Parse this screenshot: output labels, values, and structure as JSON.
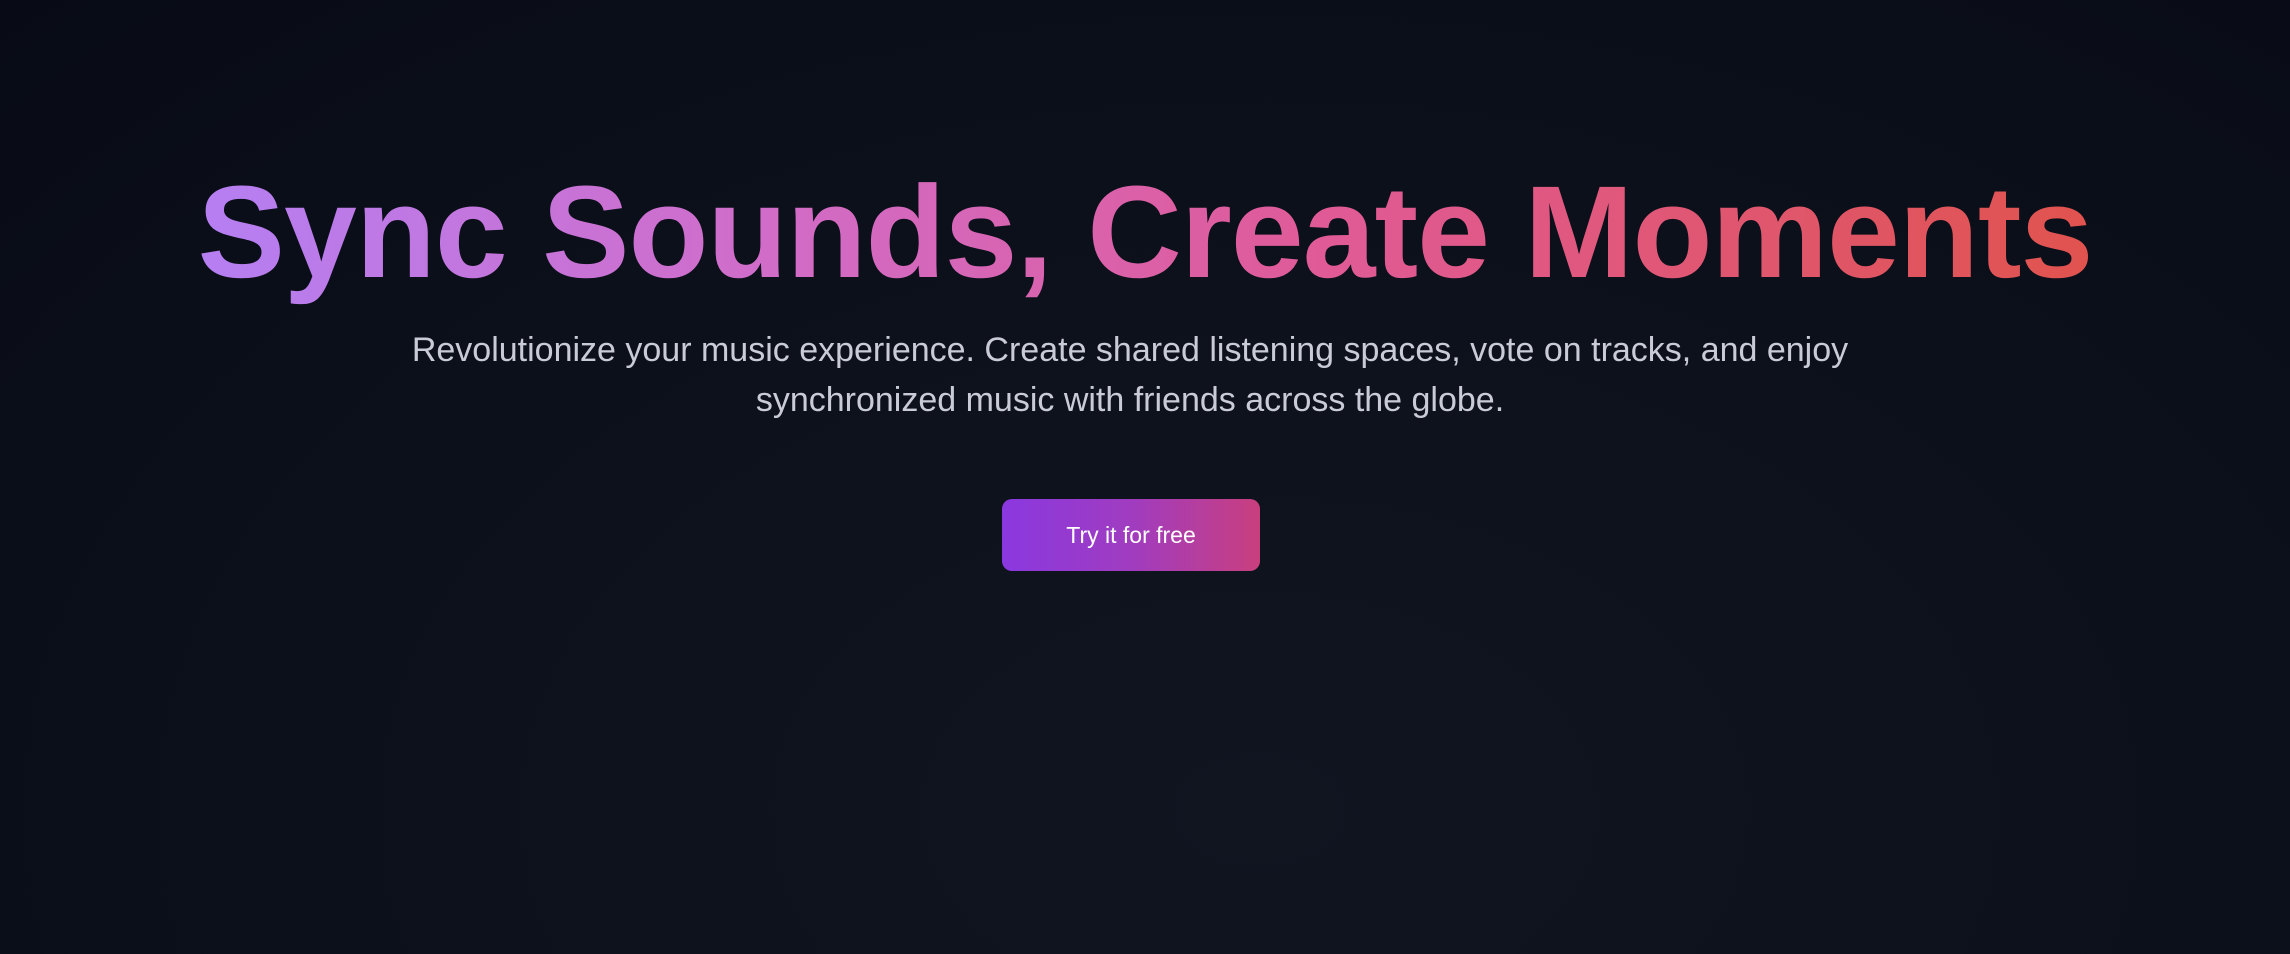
{
  "hero": {
    "title": "Sync Sounds, Create Moments",
    "subtitle": "Revolutionize your music experience. Create shared listening spaces, vote on tracks, and enjoy synchronized music with friends across the globe.",
    "cta_label": "Try it for free"
  },
  "colors": {
    "background": "#0a0e18",
    "title_gradient_start": "#b57ff2",
    "title_gradient_mid": "#e05a96",
    "title_gradient_end": "#e0534e",
    "subtitle_text": "#c9ccd6",
    "button_gradient_start": "#8a38e0",
    "button_gradient_end": "#c93f7e",
    "button_text": "#ffffff"
  }
}
